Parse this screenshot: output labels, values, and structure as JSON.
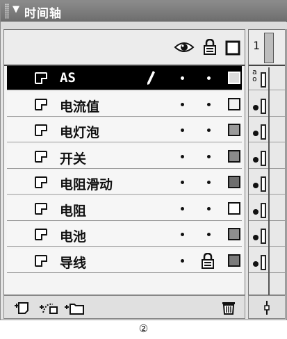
{
  "panel": {
    "collapse_glyph": "▼",
    "title": "时间轴"
  },
  "header_icons": [
    "eye-icon",
    "lock-icon",
    "outline-icon"
  ],
  "layers": [
    {
      "name": "AS",
      "selected": true,
      "locked": false,
      "swatch": "#dddddd"
    },
    {
      "name": "电流值",
      "selected": false,
      "locked": false,
      "swatch": "#f2f2f2"
    },
    {
      "name": "电灯泡",
      "selected": false,
      "locked": false,
      "swatch": "#9a9a9a"
    },
    {
      "name": "开关",
      "selected": false,
      "locked": false,
      "swatch": "#8a8a8a"
    },
    {
      "name": "电阻滑动",
      "selected": false,
      "locked": false,
      "swatch": "#6e6e6e"
    },
    {
      "name": "电阻",
      "selected": false,
      "locked": false,
      "swatch": "#ffffff"
    },
    {
      "name": "电池",
      "selected": false,
      "locked": false,
      "swatch": "#8f8f8f"
    },
    {
      "name": "导线",
      "selected": false,
      "locked": true,
      "swatch": "#7a7a7a"
    }
  ],
  "timeline": {
    "frame_number": "1",
    "action_marker": "a\no"
  },
  "footer_icons": [
    "insert-layer-icon",
    "add-motion-guide-icon",
    "insert-folder-icon",
    "delete-layer-icon"
  ],
  "caption": "②"
}
